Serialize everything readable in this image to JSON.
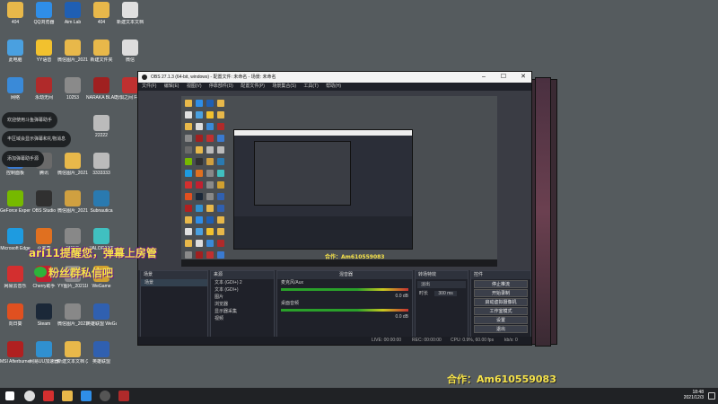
{
  "desktop_icons": [
    {
      "label": "404",
      "icon": "folder-icon",
      "color": "#e8b84a"
    },
    {
      "label": "QQ浏览器",
      "icon": "qq-browser-icon",
      "color": "#2f8ee8"
    },
    {
      "label": "Aim Lab",
      "icon": "aimlab-icon",
      "color": "#1f5fb3"
    },
    {
      "label": "404",
      "icon": "folder-icon",
      "color": "#e8b84a"
    },
    {
      "label": "新建文本文档",
      "icon": "text-document-icon",
      "color": "#e0e0e0"
    },
    {
      "label": "此电脑",
      "icon": "this-pc-icon",
      "color": "#4aa0e0"
    },
    {
      "label": "YY语音",
      "icon": "yy-voice-icon",
      "color": "#f2c12e"
    },
    {
      "label": "微信图片_2021102...",
      "icon": "image-file-icon",
      "color": "#e8b84a"
    },
    {
      "label": "新建文件夹",
      "icon": "folder-icon",
      "color": "#e8b84a"
    },
    {
      "label": "微信",
      "icon": "file-icon",
      "color": "#dddddd"
    },
    {
      "label": "网络",
      "icon": "network-icon",
      "color": "#3a8ad8"
    },
    {
      "label": "永劫无间",
      "icon": "naraka-game-icon",
      "color": "#b02a2a"
    },
    {
      "label": "10253",
      "icon": "image-file-icon",
      "color": "#8a8a8a"
    },
    {
      "label": "NARAKA BLADEPOI...",
      "icon": "naraka-game-icon",
      "color": "#a02020"
    },
    {
      "label": "恐惧之间 Fear sur...",
      "icon": "fear-game-icon",
      "color": "#c03030"
    },
    {
      "label": "控制面板",
      "icon": "control-panel-icon",
      "color": "#3a7ad0"
    },
    {
      "label": "腾讯",
      "icon": "app-icon",
      "color": "#6a6a6a"
    },
    {
      "label": "微信图片_2021102...",
      "icon": "image-file-icon",
      "color": "#e8b84a"
    },
    {
      "label": "3333333",
      "icon": "qr-code-icon",
      "color": "#bbbbbb"
    },
    {
      "label": "22222",
      "icon": "qr-code-icon",
      "color": "#bbbbbb"
    },
    {
      "label": "GeForce Experience",
      "icon": "geforce-icon",
      "color": "#76b900"
    },
    {
      "label": "OBS Studio",
      "icon": "obs-icon",
      "color": "#303030"
    },
    {
      "label": "微信图片_2021102...",
      "icon": "image-file-icon",
      "color": "#d0a040"
    },
    {
      "label": "Subnautica",
      "icon": "subnautica-icon",
      "color": "#2a7ab0"
    },
    {
      "label": "Microsoft Edge",
      "icon": "edge-icon",
      "color": "#1e9be0"
    },
    {
      "label": "小黑盒",
      "icon": "app-icon",
      "color": "#e07020"
    },
    {
      "label": "网易云",
      "icon": "app-icon",
      "color": "#888888"
    },
    {
      "label": "VALORANT",
      "icon": "game-icon",
      "color": "#40c0c0"
    },
    {
      "label": "网易云音乐",
      "icon": "netease-music-icon",
      "color": "#d32f2f"
    },
    {
      "label": "Cherry助手",
      "icon": "cherry-icon",
      "color": "#c02030"
    },
    {
      "label": "YY图片_2021102...",
      "icon": "image-file-icon",
      "color": "#8a8a8a"
    },
    {
      "label": "WeGame",
      "icon": "wegame-icon",
      "color": "#d0a030"
    },
    {
      "label": "向日葵",
      "icon": "sunlogin-icon",
      "color": "#e05020"
    },
    {
      "label": "Steam",
      "icon": "steam-icon",
      "color": "#1b2838"
    },
    {
      "label": "微信图片_2021102...",
      "icon": "image-file-icon",
      "color": "#888888"
    },
    {
      "label": "英雄联盟 WeGame版",
      "icon": "lol-icon",
      "color": "#3060b0"
    },
    {
      "label": "MSI Afterburner",
      "icon": "msi-icon",
      "color": "#b02020"
    },
    {
      "label": "网易UU加速器",
      "icon": "uu-icon",
      "color": "#3090d0"
    },
    {
      "label": "新建文本文档 (2)",
      "icon": "folder-icon",
      "color": "#e8b84a"
    },
    {
      "label": "英雄联盟",
      "icon": "lol-icon",
      "color": "#3060b0"
    }
  ],
  "notifications": [
    "欢迎使用斗鱼弹幕助手",
    "丰区域会显示弹幕和礼物消息",
    "添加弹幕助手源"
  ],
  "overlays": {
    "scrolling_text": "ari11提醒您，弹幕上房管",
    "wechat_text": "粉丝群私信吧",
    "contact": "合作：Am610559083",
    "contact_small": "合作：Am610559083"
  },
  "obs": {
    "title": "OBS 27.1.3 (64-bit, windows) - 配置文件: 未命名 - 场景: 未命名",
    "menu": [
      "文件(F)",
      "编辑(E)",
      "视图(V)",
      "停靠部件(D)",
      "配置文件(P)",
      "场景集合(S)",
      "工具(T)",
      "帮助(H)"
    ],
    "docks": {
      "scenes": {
        "title": "场景",
        "items": [
          "场景"
        ]
      },
      "sources": {
        "title": "来源",
        "items": [
          "文本 (GDI+) 2",
          "文本 (GDI+)",
          "图片",
          "浏览器",
          "显示器采集",
          "视频"
        ]
      },
      "mixer": {
        "title": "混音器",
        "channels": [
          {
            "name": "麦克风/Aux",
            "level": "0.0 dB"
          },
          {
            "name": "桌面音频",
            "level": "0.0 dB"
          }
        ]
      },
      "transitions": {
        "title": "转场特效",
        "type": "淡出",
        "duration_label": "时长",
        "duration": "300 ms"
      },
      "controls": {
        "title": "控件",
        "buttons": [
          "停止推流",
          "开始录制",
          "启动虚拟摄像机",
          "工作室模式",
          "设置",
          "退出"
        ]
      }
    },
    "status": {
      "live": "LIVE: 00:00:00",
      "rec": "REC: 00:00:00",
      "cpu": "CPU: 0.9%, 60.00 fps",
      "kbps": "kb/s: 0"
    }
  },
  "taskbar": {
    "time": "18:48",
    "date": "2021/12/3",
    "apps": [
      "start-icon",
      "search-icon",
      "netease-music-icon",
      "file-explorer-icon",
      "qq-browser-icon",
      "obs-icon",
      "naraka-game-icon"
    ]
  }
}
